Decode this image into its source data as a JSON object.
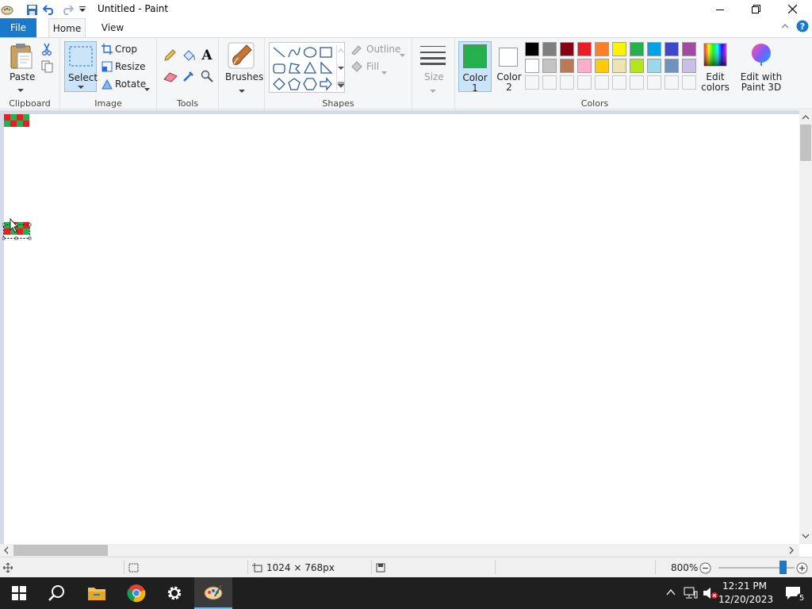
{
  "window": {
    "title": "Untitled - Paint"
  },
  "tabs": {
    "file": "File",
    "home": "Home",
    "view": "View"
  },
  "clipboard": {
    "paste": "Paste",
    "group": "Clipboard"
  },
  "image": {
    "select": "Select",
    "crop": "Crop",
    "resize": "Resize",
    "rotate": "Rotate",
    "group": "Image"
  },
  "tools": {
    "group": "Tools"
  },
  "brushes": {
    "label": "Brushes"
  },
  "shapes": {
    "outline": "Outline",
    "fill": "Fill",
    "group": "Shapes"
  },
  "size": {
    "label": "Size"
  },
  "colors": {
    "color1": "Color",
    "color1_num": "1",
    "color2": "Color",
    "color2_num": "2",
    "edit_colors_1": "Edit",
    "edit_colors_2": "colors",
    "group": "Colors",
    "color1_value": "#22b14c",
    "color2_value": "#ffffff",
    "palette_row1": [
      "#000000",
      "#7f7f7f",
      "#880015",
      "#ed1c24",
      "#ff7f27",
      "#fff200",
      "#22b14c",
      "#00a2e8",
      "#3f48cc",
      "#a349a4"
    ],
    "palette_row2": [
      "#ffffff",
      "#c3c3c3",
      "#b97a57",
      "#ffaec9",
      "#ffc90e",
      "#efe4b0",
      "#b5e61d",
      "#99d9ea",
      "#7092be",
      "#c8bfe7"
    ]
  },
  "paint3d": {
    "line1": "Edit with",
    "line2": "Paint 3D"
  },
  "status": {
    "dimensions": "1024 × 768px",
    "zoom": "800%"
  },
  "taskbar": {
    "time": "12:21 PM",
    "date": "12/20/2023",
    "notifications": "5"
  }
}
